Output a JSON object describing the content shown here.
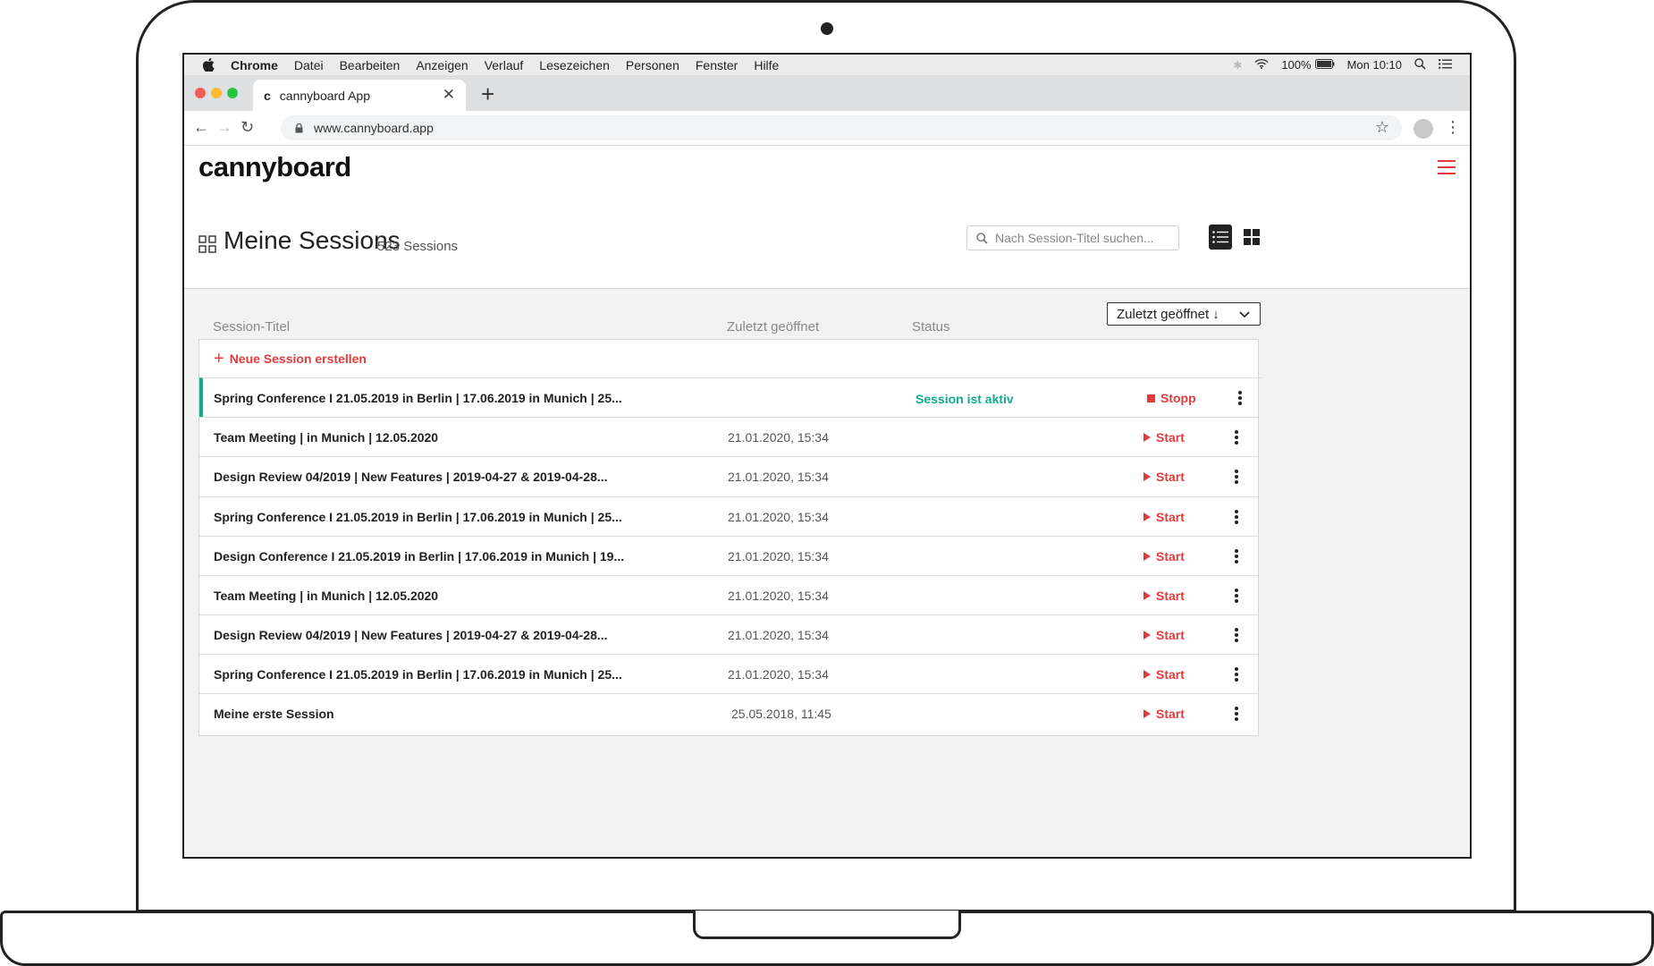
{
  "mac_menu": {
    "app": "Chrome",
    "items": [
      "Datei",
      "Bearbeiten",
      "Anzeigen",
      "Verlauf",
      "Lesezeichen",
      "Personen",
      "Fenster",
      "Hilfe"
    ],
    "battery": "100%",
    "clock": "Mon 10:10"
  },
  "browser": {
    "tab_title": "cannyboard App",
    "tab_favicon": "c",
    "url": "www.cannyboard.app"
  },
  "app": {
    "logo": "cannyboard",
    "accent_color": "#e03c3c",
    "active_color": "#13a98d"
  },
  "page": {
    "title": "Meine Sessions",
    "count": "523 Sessions",
    "search_placeholder": "Nach Session-Titel suchen...",
    "sort_label": "Zuletzt geöffnet ↓"
  },
  "table": {
    "columns": [
      "Session-Titel",
      "Zuletzt geöffnet",
      "Status"
    ],
    "new_session": "Neue Session erstellen",
    "rows": [
      {
        "title": "Spring Conference I 21.05.2019 in Berlin | 17.06.2019 in Munich | 25...",
        "date": "",
        "status": "Session ist aktiv",
        "action": "Stopp"
      },
      {
        "title": "Team Meeting | in Munich | 12.05.2020",
        "date": "21.01.2020, 15:34",
        "status": "",
        "action": "Start"
      },
      {
        "title": "Design Review 04/2019 | New Features | 2019-04-27 & 2019-04-28...",
        "date": "21.01.2020, 15:34",
        "status": "",
        "action": "Start"
      },
      {
        "title": "Spring Conference I 21.05.2019 in Berlin | 17.06.2019 in Munich | 25...",
        "date": "21.01.2020, 15:34",
        "status": "",
        "action": "Start"
      },
      {
        "title": "Design Conference I 21.05.2019 in Berlin | 17.06.2019 in Munich | 19...",
        "date": "21.01.2020, 15:34",
        "status": "",
        "action": "Start"
      },
      {
        "title": "Team Meeting | in Munich | 12.05.2020",
        "date": "21.01.2020, 15:34",
        "status": "",
        "action": "Start"
      },
      {
        "title": "Design Review 04/2019 | New Features | 2019-04-27 & 2019-04-28...",
        "date": "21.01.2020, 15:34",
        "status": "",
        "action": "Start"
      },
      {
        "title": "Spring Conference I 21.05.2019 in Berlin | 17.06.2019 in Munich | 25...",
        "date": "21.01.2020, 15:34",
        "status": "",
        "action": "Start"
      },
      {
        "title": "Meine erste Session",
        "date": "25.05.2018, 11:45",
        "status": "",
        "action": "Start"
      }
    ]
  }
}
